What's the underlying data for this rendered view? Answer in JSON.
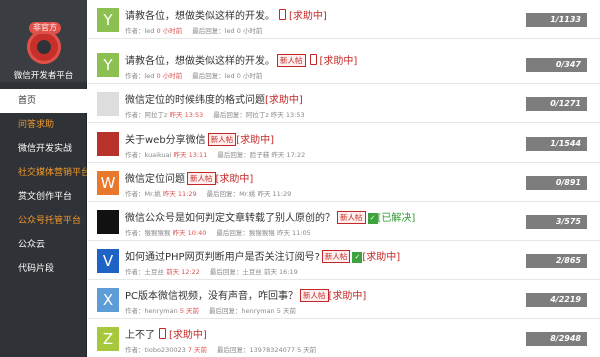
{
  "sidebar": {
    "logo_badge": "非官方",
    "logo_text": "微信开发者平台",
    "items": [
      {
        "label": "首页",
        "state": "active"
      },
      {
        "label": "问答求助",
        "state": "orange"
      },
      {
        "label": "微信开发实战",
        "state": "normal"
      },
      {
        "label": "社交媒体营销平台",
        "state": "orange"
      },
      {
        "label": "赏文创作平台",
        "state": "normal"
      },
      {
        "label": "公众号托管平台",
        "state": "orange"
      },
      {
        "label": "公众云",
        "state": "normal"
      },
      {
        "label": "代码片段",
        "state": "normal"
      }
    ]
  },
  "labels": {
    "author": "作者：",
    "last_reply": "最后回复："
  },
  "posts": [
    {
      "avatar_letter": "Y",
      "avatar_color": "#8cc152",
      "title": "请教各位，想做类似这样的开发。",
      "new_tag": "",
      "phone": true,
      "check": false,
      "status": "[求助中]",
      "status_ok": false,
      "author": "led",
      "author_time": "0 小时前",
      "reply_user": "led",
      "reply_time": "0 小时前",
      "count": "1/1133"
    },
    {
      "avatar_letter": "Y",
      "avatar_color": "#8cc152",
      "title": "请教各位，想做类似这样的开发。",
      "new_tag": "新人帖",
      "phone": true,
      "check": false,
      "status": "[求助中]",
      "status_ok": false,
      "author": "led",
      "author_time": "0 小时前",
      "reply_user": "led",
      "reply_time": "0 小时前",
      "count": "0/347"
    },
    {
      "avatar_letter": "",
      "avatar_color": "#dddddd",
      "title": "微信定位的时候纬度的格式问题",
      "new_tag": "",
      "phone": false,
      "check": false,
      "status": "[求助中]",
      "status_ok": false,
      "author": "阿拉丁z",
      "author_time": "昨天 13:53",
      "reply_user": "阿拉丁z",
      "reply_time": "昨天 13:53",
      "count": "0/1271"
    },
    {
      "avatar_letter": "",
      "avatar_color": "#b8322c",
      "title": "关于web分享微信",
      "new_tag": "新人帖",
      "phone": false,
      "check": false,
      "status": "[求助中]",
      "status_ok": false,
      "author": "kuaikuai",
      "author_time": "昨天 13:11",
      "reply_user": "脸子糕",
      "reply_time": "昨天 17:22",
      "count": "1/1544"
    },
    {
      "avatar_letter": "W",
      "avatar_color": "#e8782b",
      "title": "微信定位问题",
      "new_tag": "新人帖",
      "phone": false,
      "check": false,
      "status": "[求助中]",
      "status_ok": false,
      "author": "Mr.姚",
      "author_time": "昨天 11:29",
      "reply_user": "Mr.姚",
      "reply_time": "昨天 11:29",
      "count": "0/891"
    },
    {
      "avatar_letter": "",
      "avatar_color": "#111111",
      "title": "微信公众号是如何判定文章转载了别人原创的？",
      "new_tag": "新人帖",
      "phone": false,
      "check": true,
      "status": "[已解决]",
      "status_ok": true,
      "author": "猴猴猴猴",
      "author_time": "昨天 10:40",
      "reply_user": "猴猴猴猴",
      "reply_time": "昨天 11:05",
      "count": "3/575"
    },
    {
      "avatar_letter": "V",
      "avatar_color": "#1f63c7",
      "title": "如何通过PHP网页判断用户是否关注订阅号?",
      "new_tag": "新人帖",
      "phone": false,
      "check": true,
      "status": "[求助中]",
      "status_ok": false,
      "author": "土豆丝",
      "author_time": "前天 12:22",
      "reply_user": "土豆丝",
      "reply_time": "前天 16:19",
      "count": "2/865"
    },
    {
      "avatar_letter": "X",
      "avatar_color": "#5c9dd8",
      "title": "PC版本微信视频，没有声音，咋回事？",
      "new_tag": "新人帖",
      "phone": false,
      "check": false,
      "status": "[求助中]",
      "status_ok": false,
      "author": "henryman",
      "author_time": "5 天前",
      "reply_user": "henryman",
      "reply_time": "5 天前",
      "count": "4/2219"
    },
    {
      "avatar_letter": "Z",
      "avatar_color": "#a7c83c",
      "title": "上不了",
      "new_tag": "",
      "phone": true,
      "check": false,
      "status": "[求助中]",
      "status_ok": false,
      "author": "tiobo230023",
      "author_time": "7 天前",
      "reply_user": "13978324077",
      "reply_time": "5 天前",
      "count": "8/2948"
    }
  ]
}
